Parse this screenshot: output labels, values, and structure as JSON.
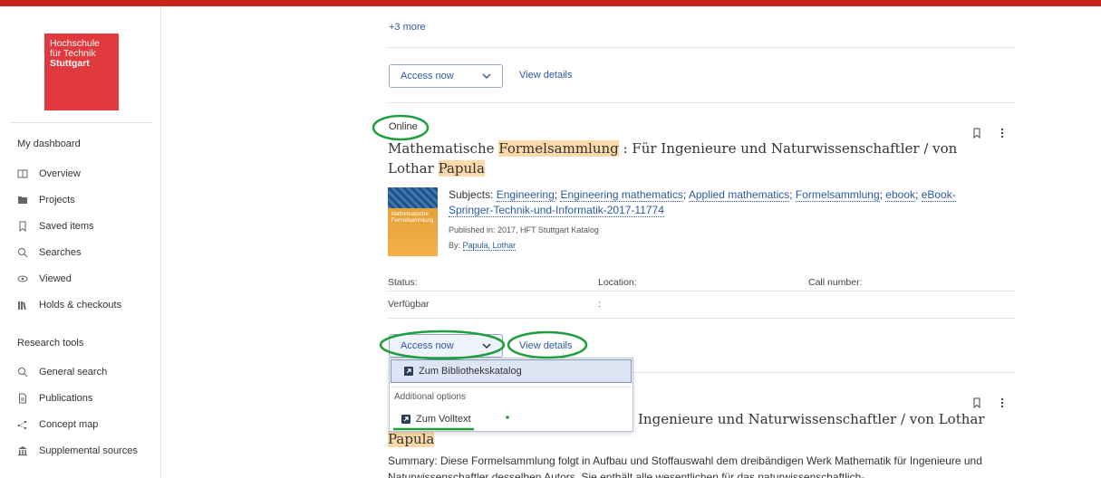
{
  "colors": {
    "top_bar": "#c8261c",
    "logo_bg": "#e0393e",
    "link": "#2c5aa0",
    "highlight": "#fcd9a8",
    "annotation": "#1e9e3c"
  },
  "logo": {
    "line1": "Hochschule",
    "line2": "für Technik",
    "line3": "Stuttgart"
  },
  "sidebar": {
    "dashboard_heading": "My dashboard",
    "dashboard_items": [
      {
        "label": "Overview",
        "icon": "overview-icon"
      },
      {
        "label": "Projects",
        "icon": "folder-icon"
      },
      {
        "label": "Saved items",
        "icon": "bookmark-icon"
      },
      {
        "label": "Searches",
        "icon": "search-history-icon"
      },
      {
        "label": "Viewed",
        "icon": "eye-icon"
      },
      {
        "label": "Holds & checkouts",
        "icon": "books-icon"
      }
    ],
    "tools_heading": "Research tools",
    "tools_items": [
      {
        "label": "General search",
        "icon": "search-icon"
      },
      {
        "label": "Publications",
        "icon": "document-icon"
      },
      {
        "label": "Concept map",
        "icon": "concept-map-icon"
      },
      {
        "label": "Supplemental sources",
        "icon": "institution-icon"
      }
    ]
  },
  "prev_result": {
    "more_link": "+3 more",
    "access_label": "Access now",
    "view_details": "View details"
  },
  "result": {
    "availability": "Online",
    "title_part1": "Mathematische ",
    "title_highlight": "Formelsammlung",
    "title_part2": " : Für Ingenieure und Naturwissenschaftler / von Lothar ",
    "title_highlight2": "Papula",
    "cover_text": "Mathematische Formelsammlung",
    "subjects_label": "Subjects:",
    "subjects": [
      "Engineering",
      "Engineering mathematics",
      "Applied mathematics",
      "Formelsammlung",
      "ebook",
      "eBook-Springer-Technik-und-Informatik-2017-11774"
    ],
    "published": "Published in: 2017, HFT Stuttgart Katalog",
    "by_label": "By:",
    "author": "Papula, Lothar",
    "table_headers": {
      "status": "Status:",
      "location": "Location:",
      "call_number": "Call number:"
    },
    "table_values": {
      "status": "Verfügbar",
      "location": ":",
      "call_number": ""
    },
    "access_label": "Access now",
    "view_details": "View details"
  },
  "dropdown": {
    "primary_option": "Zum Bibliothekskatalog",
    "section_label": "Additional options",
    "secondary_option": "Zum Volltext"
  },
  "next_result": {
    "title_part2": "Ingenieure und Naturwissenschaftler / von Lothar",
    "title_highlight2": "Papula",
    "summary": "Summary: Diese Formelsammlung folgt in Aufbau und Stoffauswahl dem dreibändigen Werk Mathematik für Ingenieure und Naturwissenschaftler desselben Autors. Sie enthält alle wesentlichen für das naturwissenschaftlich-"
  }
}
